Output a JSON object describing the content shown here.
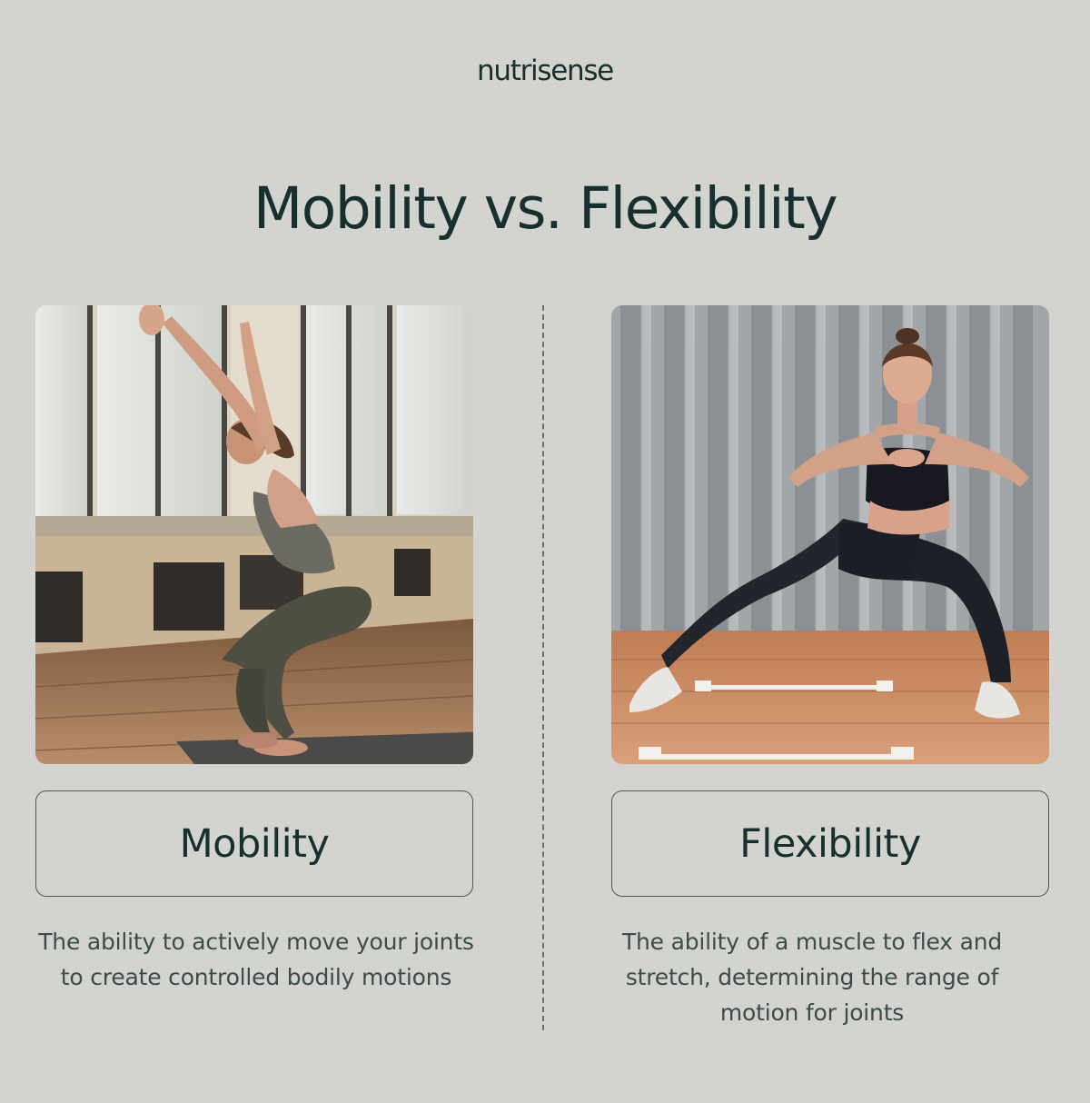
{
  "brand": {
    "logo_text": "nutrisense"
  },
  "header": {
    "title": "Mobility vs. Flexibility"
  },
  "panels": [
    {
      "label": "Mobility",
      "description": "The ability to actively move your joints to create controlled bodily motions",
      "photo_subject": "woman-squatting-arms-raised"
    },
    {
      "label": "Flexibility",
      "description": "The ability of a muscle to flex and stretch, determining the range of motion for joints",
      "photo_subject": "woman-side-lunge-stretch"
    }
  ],
  "colors": {
    "background": "#d3d3d0",
    "text": "#17302f",
    "border": "#4f5857"
  }
}
